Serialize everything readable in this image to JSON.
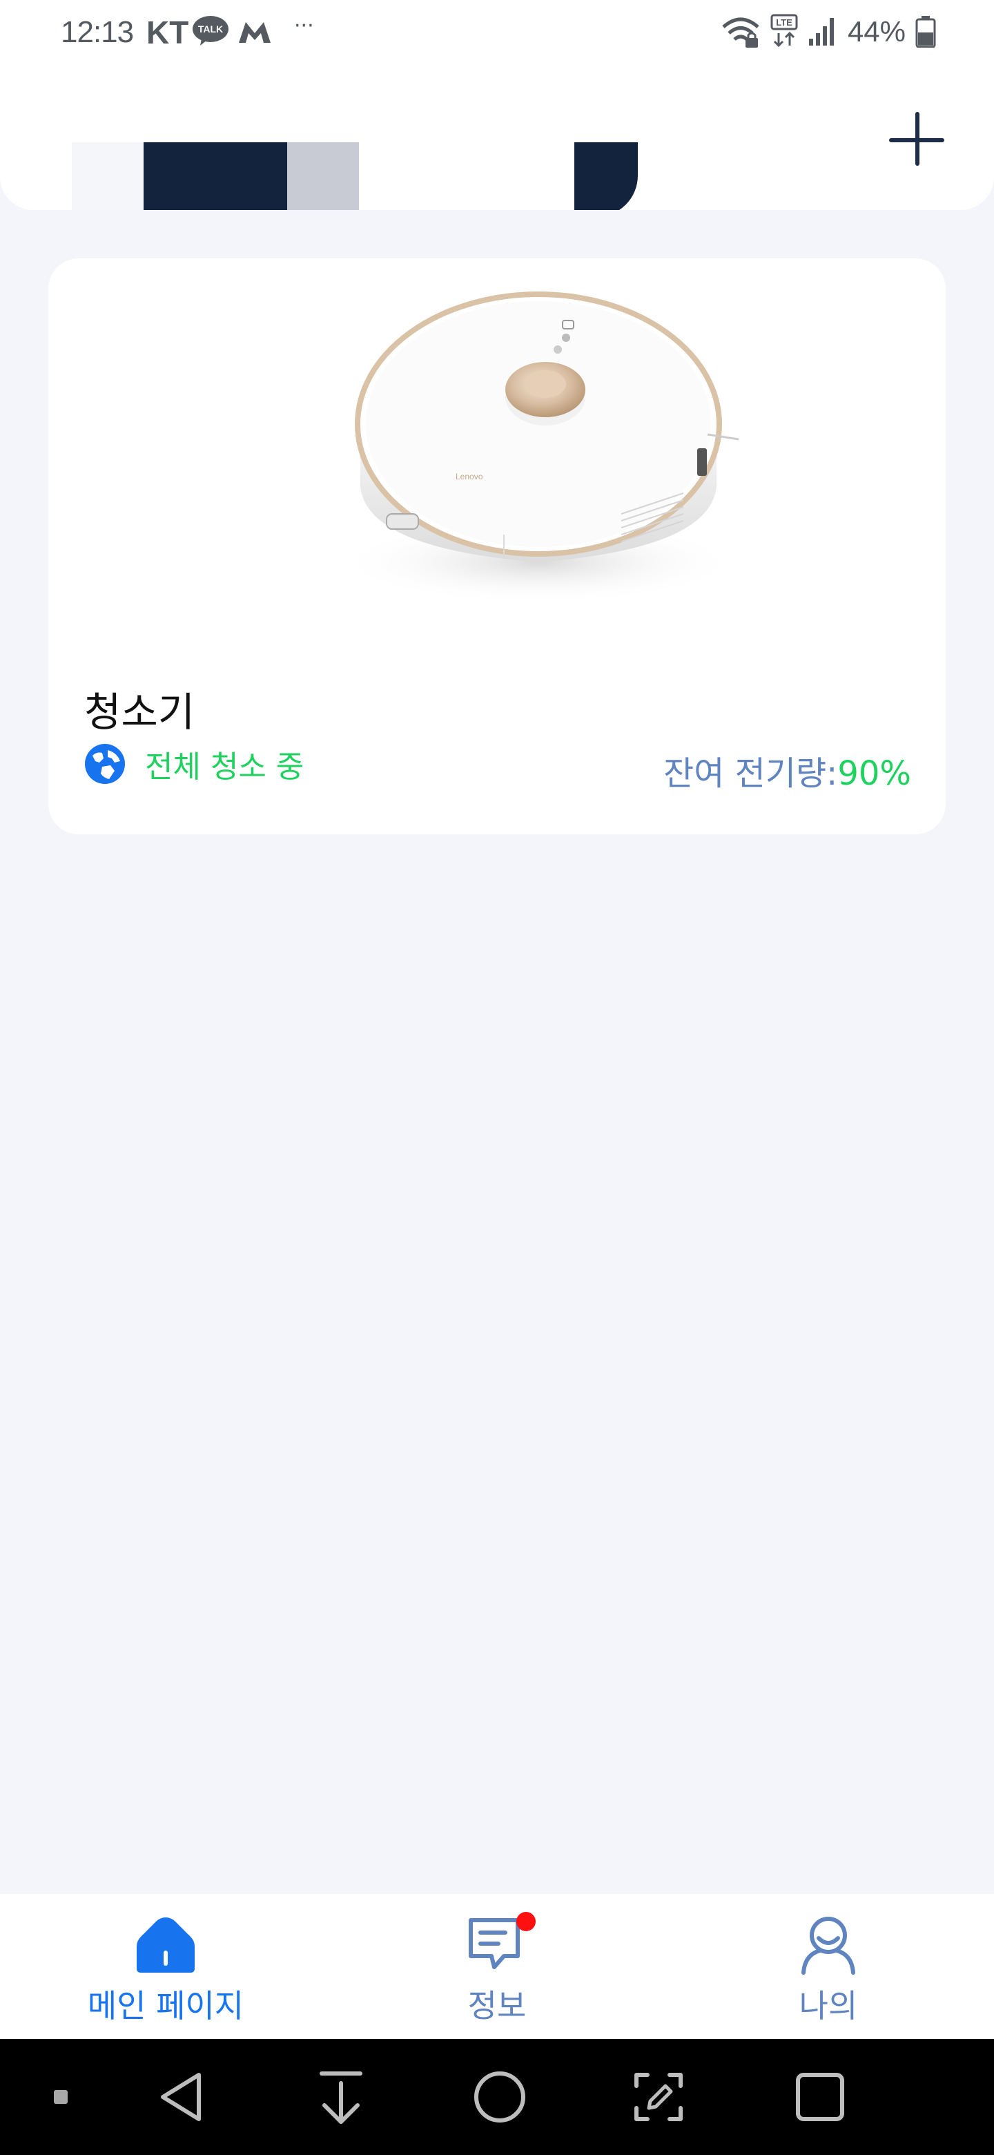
{
  "status_bar": {
    "time": "12:13",
    "carrier": "KT",
    "talk_badge": "TALK",
    "overflow": "···",
    "network": "LTE",
    "battery": "44%"
  },
  "header": {
    "add_icon": "plus-icon"
  },
  "device": {
    "name": "청소기",
    "status": "전체 청소 중",
    "battery_label": "잔여 전기량:",
    "battery_value": "90%",
    "brand_on_device": "Lenovo"
  },
  "bottom_nav": {
    "items": [
      {
        "label": "메인 페이지",
        "icon": "home-icon",
        "active": true
      },
      {
        "label": "정보",
        "icon": "message-icon",
        "active": false
      },
      {
        "label": "나의",
        "icon": "user-icon",
        "active": false
      }
    ]
  },
  "system_nav": {
    "buttons": [
      "menu-square-icon",
      "back-icon",
      "download-icon",
      "home-circle-icon",
      "edit-capture-icon",
      "recents-icon"
    ]
  },
  "colors": {
    "background": "#f4f5fa",
    "accent": "#1773ee",
    "status_green": "#1fd15e",
    "muted_blue": "#5f84c0",
    "navy": "#13233d",
    "badge_red": "#ff1010"
  }
}
